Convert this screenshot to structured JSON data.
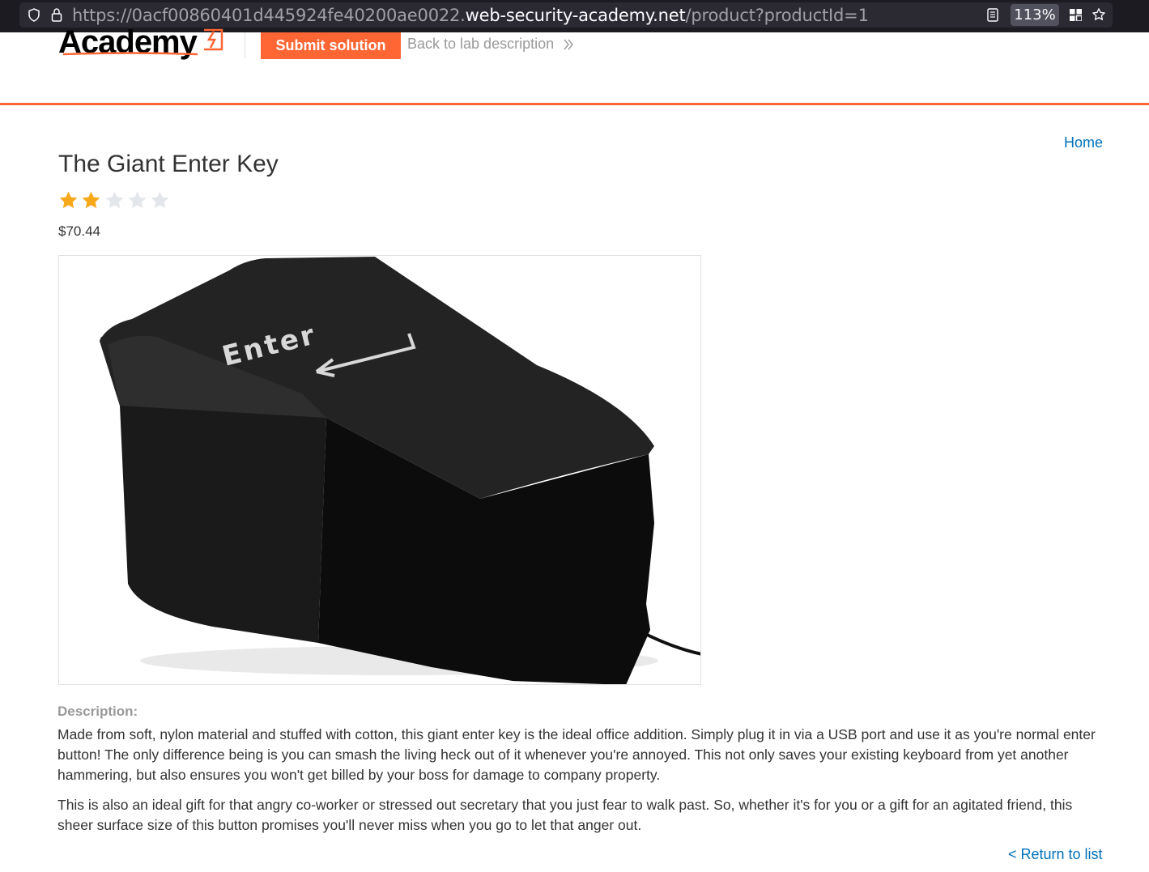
{
  "browser": {
    "url_prefix": "https://0acf00860401d445924fe40200ae0022.",
    "url_domain": "web-security-academy.net",
    "url_path": "/product?productId=1",
    "zoom": "113%"
  },
  "header": {
    "logo_text": "Academy",
    "submit_label": "Submit solution",
    "back_label": "Back to lab description"
  },
  "nav": {
    "home_label": "Home"
  },
  "product": {
    "title": "The Giant Enter Key",
    "rating_filled": 2,
    "rating_max": 5,
    "price": "$70.44",
    "image_key_label": "Enter",
    "description_label": "Description:",
    "description_p1": "Made from soft, nylon material and stuffed with cotton, this giant enter key is the ideal office addition. Simply plug it in via a USB port and use it as you're normal enter button! The only difference being is you can smash the living heck out of it whenever you're annoyed. This not only saves your existing keyboard from yet another hammering, but also ensures you won't get billed by your boss for damage to company property.",
    "description_p2": "This is also an ideal gift for that angry co-worker or stressed out secretary that you just fear to walk past. So, whether it's for you or a gift for an agitated friend, this sheer surface size of this button promises you'll never miss when you go to let that anger out."
  },
  "footer": {
    "return_label": "< Return to list"
  },
  "colors": {
    "accent": "#ff6633",
    "link": "#0071bc",
    "star_filled": "#f7a81b",
    "star_empty": "#e3e6ea"
  }
}
